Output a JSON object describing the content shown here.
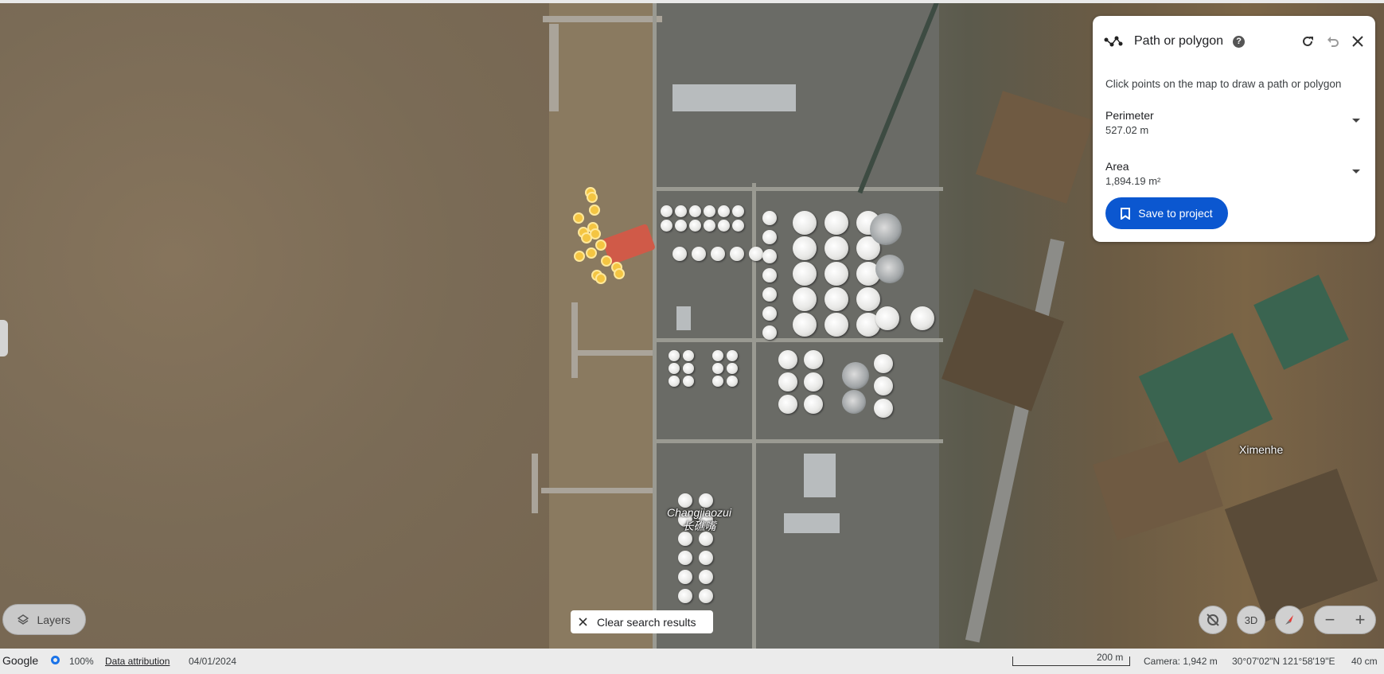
{
  "panel": {
    "title": "Path or polygon",
    "hint": "Click points on the map to draw a path or polygon",
    "perimeter_label": "Perimeter",
    "perimeter_value": "527.02 m",
    "area_label": "Area",
    "area_value": "1,894.19 m²",
    "save_label": "Save to project"
  },
  "map": {
    "labels": {
      "changjiaozui": "Changjiaozui",
      "changjiaozui_cn": "长礁嘴",
      "ximenhe": "Ximenhe"
    }
  },
  "controls": {
    "layers_label": "Layers",
    "clear_label": "Clear search results",
    "three_d_label": "3D"
  },
  "status": {
    "brand": "Google",
    "progress": "100%",
    "attribution": "Data attribution",
    "date": "04/01/2024",
    "scale": "200 m",
    "camera": "Camera: 1,942 m",
    "coords": "30°07'02\"N 121°58'19\"E",
    "resolution": "40 cm"
  },
  "colors": {
    "accent": "#0b57d0",
    "marker": "#f4c542"
  }
}
